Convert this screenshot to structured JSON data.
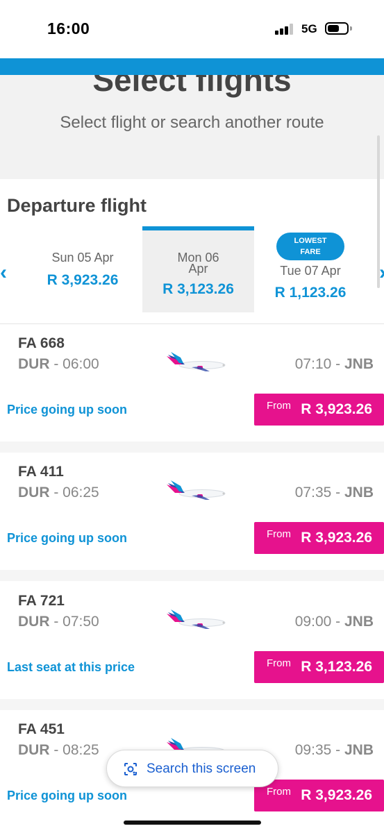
{
  "status": {
    "time": "16:00",
    "network": "5G"
  },
  "header": {
    "title": "Select flights",
    "subtitle": "Select flight or search another route"
  },
  "departure": {
    "title": "Departure flight",
    "dates": [
      {
        "day": "Sun 05 Apr",
        "price": "R 3,923.26",
        "selected": false
      },
      {
        "day": "Mon 06 Apr",
        "price": "R 3,123.26",
        "selected": true
      },
      {
        "day": "Tue 07 Apr",
        "price": "R 1,123.26",
        "selected": false,
        "badge": "LOWEST FARE"
      }
    ]
  },
  "flights": [
    {
      "number": "FA 668",
      "from": "DUR",
      "dep_time": "06:00",
      "arr_time": "07:10",
      "to": "JNB",
      "note": "Price going up soon",
      "from_label": "From",
      "price": "R 3,923.26"
    },
    {
      "number": "FA 411",
      "from": "DUR",
      "dep_time": "06:25",
      "arr_time": "07:35",
      "to": "JNB",
      "note": "Price going up soon",
      "from_label": "From",
      "price": "R 3,923.26"
    },
    {
      "number": "FA 721",
      "from": "DUR",
      "dep_time": "07:50",
      "arr_time": "09:00",
      "to": "JNB",
      "note": "Last seat at this price",
      "from_label": "From",
      "price": "R 3,123.26"
    },
    {
      "number": "FA 451",
      "from": "DUR",
      "dep_time": "08:25",
      "arr_time": "09:35",
      "to": "JNB",
      "note": "Price going up soon",
      "from_label": "From",
      "price": "R 3,923.26"
    }
  ],
  "search_button": {
    "label": "Search this screen"
  },
  "colors": {
    "brand_blue": "#0f93d6",
    "brand_pink": "#e6128d"
  }
}
